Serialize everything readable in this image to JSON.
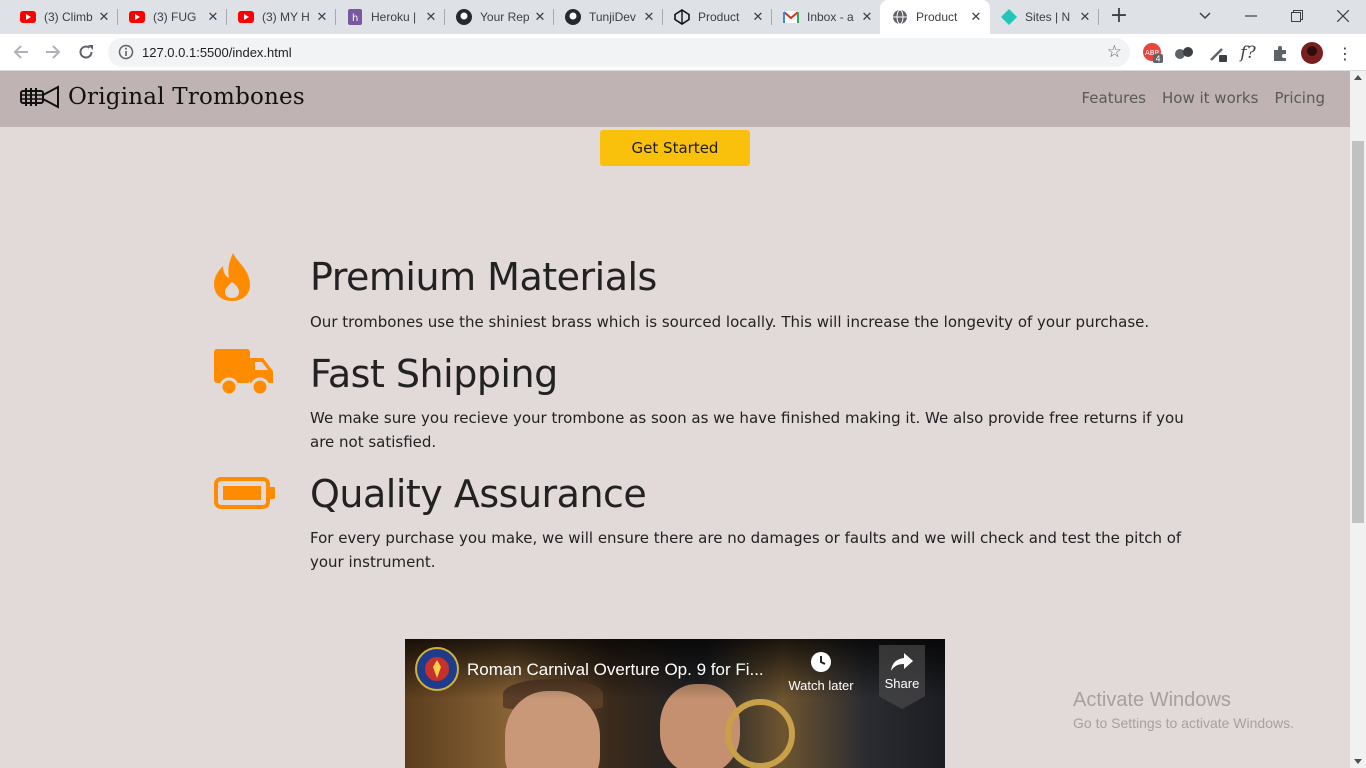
{
  "browser": {
    "tabs": [
      {
        "title": "(3) Climb",
        "icon": "youtube-icon"
      },
      {
        "title": "(3) FUG",
        "icon": "youtube-icon"
      },
      {
        "title": "(3) MY H",
        "icon": "youtube-icon"
      },
      {
        "title": "Heroku |",
        "icon": "heroku-icon"
      },
      {
        "title": "Your Rep",
        "icon": "github-icon"
      },
      {
        "title": "TunjiDev",
        "icon": "github-icon"
      },
      {
        "title": "Product",
        "icon": "codepen-icon"
      },
      {
        "title": "Inbox - a",
        "icon": "gmail-icon"
      },
      {
        "title": "Product",
        "icon": "globe-icon"
      },
      {
        "title": "Sites | N",
        "icon": "netlify-icon"
      }
    ],
    "active_tab_index": 8,
    "url": "127.0.0.1:5500/index.html",
    "extension_badge": "4"
  },
  "site": {
    "logo_text": "Original Trombones",
    "nav": [
      "Features",
      "How it works",
      "Pricing"
    ],
    "cta_label": "Get Started"
  },
  "features": [
    {
      "icon": "fire-icon",
      "title": "Premium Materials",
      "desc": "Our trombones use the shiniest brass which is sourced locally. This will increase the longevity of your purchase."
    },
    {
      "icon": "truck-icon",
      "title": "Fast Shipping",
      "desc": "We make sure you recieve your trombone as soon as we have finished making it. We also provide free returns if you are not satisfied."
    },
    {
      "icon": "battery-icon",
      "title": "Quality Assurance",
      "desc": "For every purchase you make, we will ensure there are no damages or faults and we will check and test the pitch of your instrument."
    }
  ],
  "video": {
    "title": "Roman Carnival Overture Op. 9 for Fi...",
    "watch_later_label": "Watch later",
    "share_label": "Share"
  },
  "os_watermark": {
    "line1": "Activate Windows",
    "line2": "Go to Settings to activate Windows."
  },
  "colors": {
    "accent_orange": "#ff8c00",
    "cta_yellow": "#f9c10b",
    "page_bg": "#e2d9d9",
    "header_bg": "#bfb4b3"
  }
}
